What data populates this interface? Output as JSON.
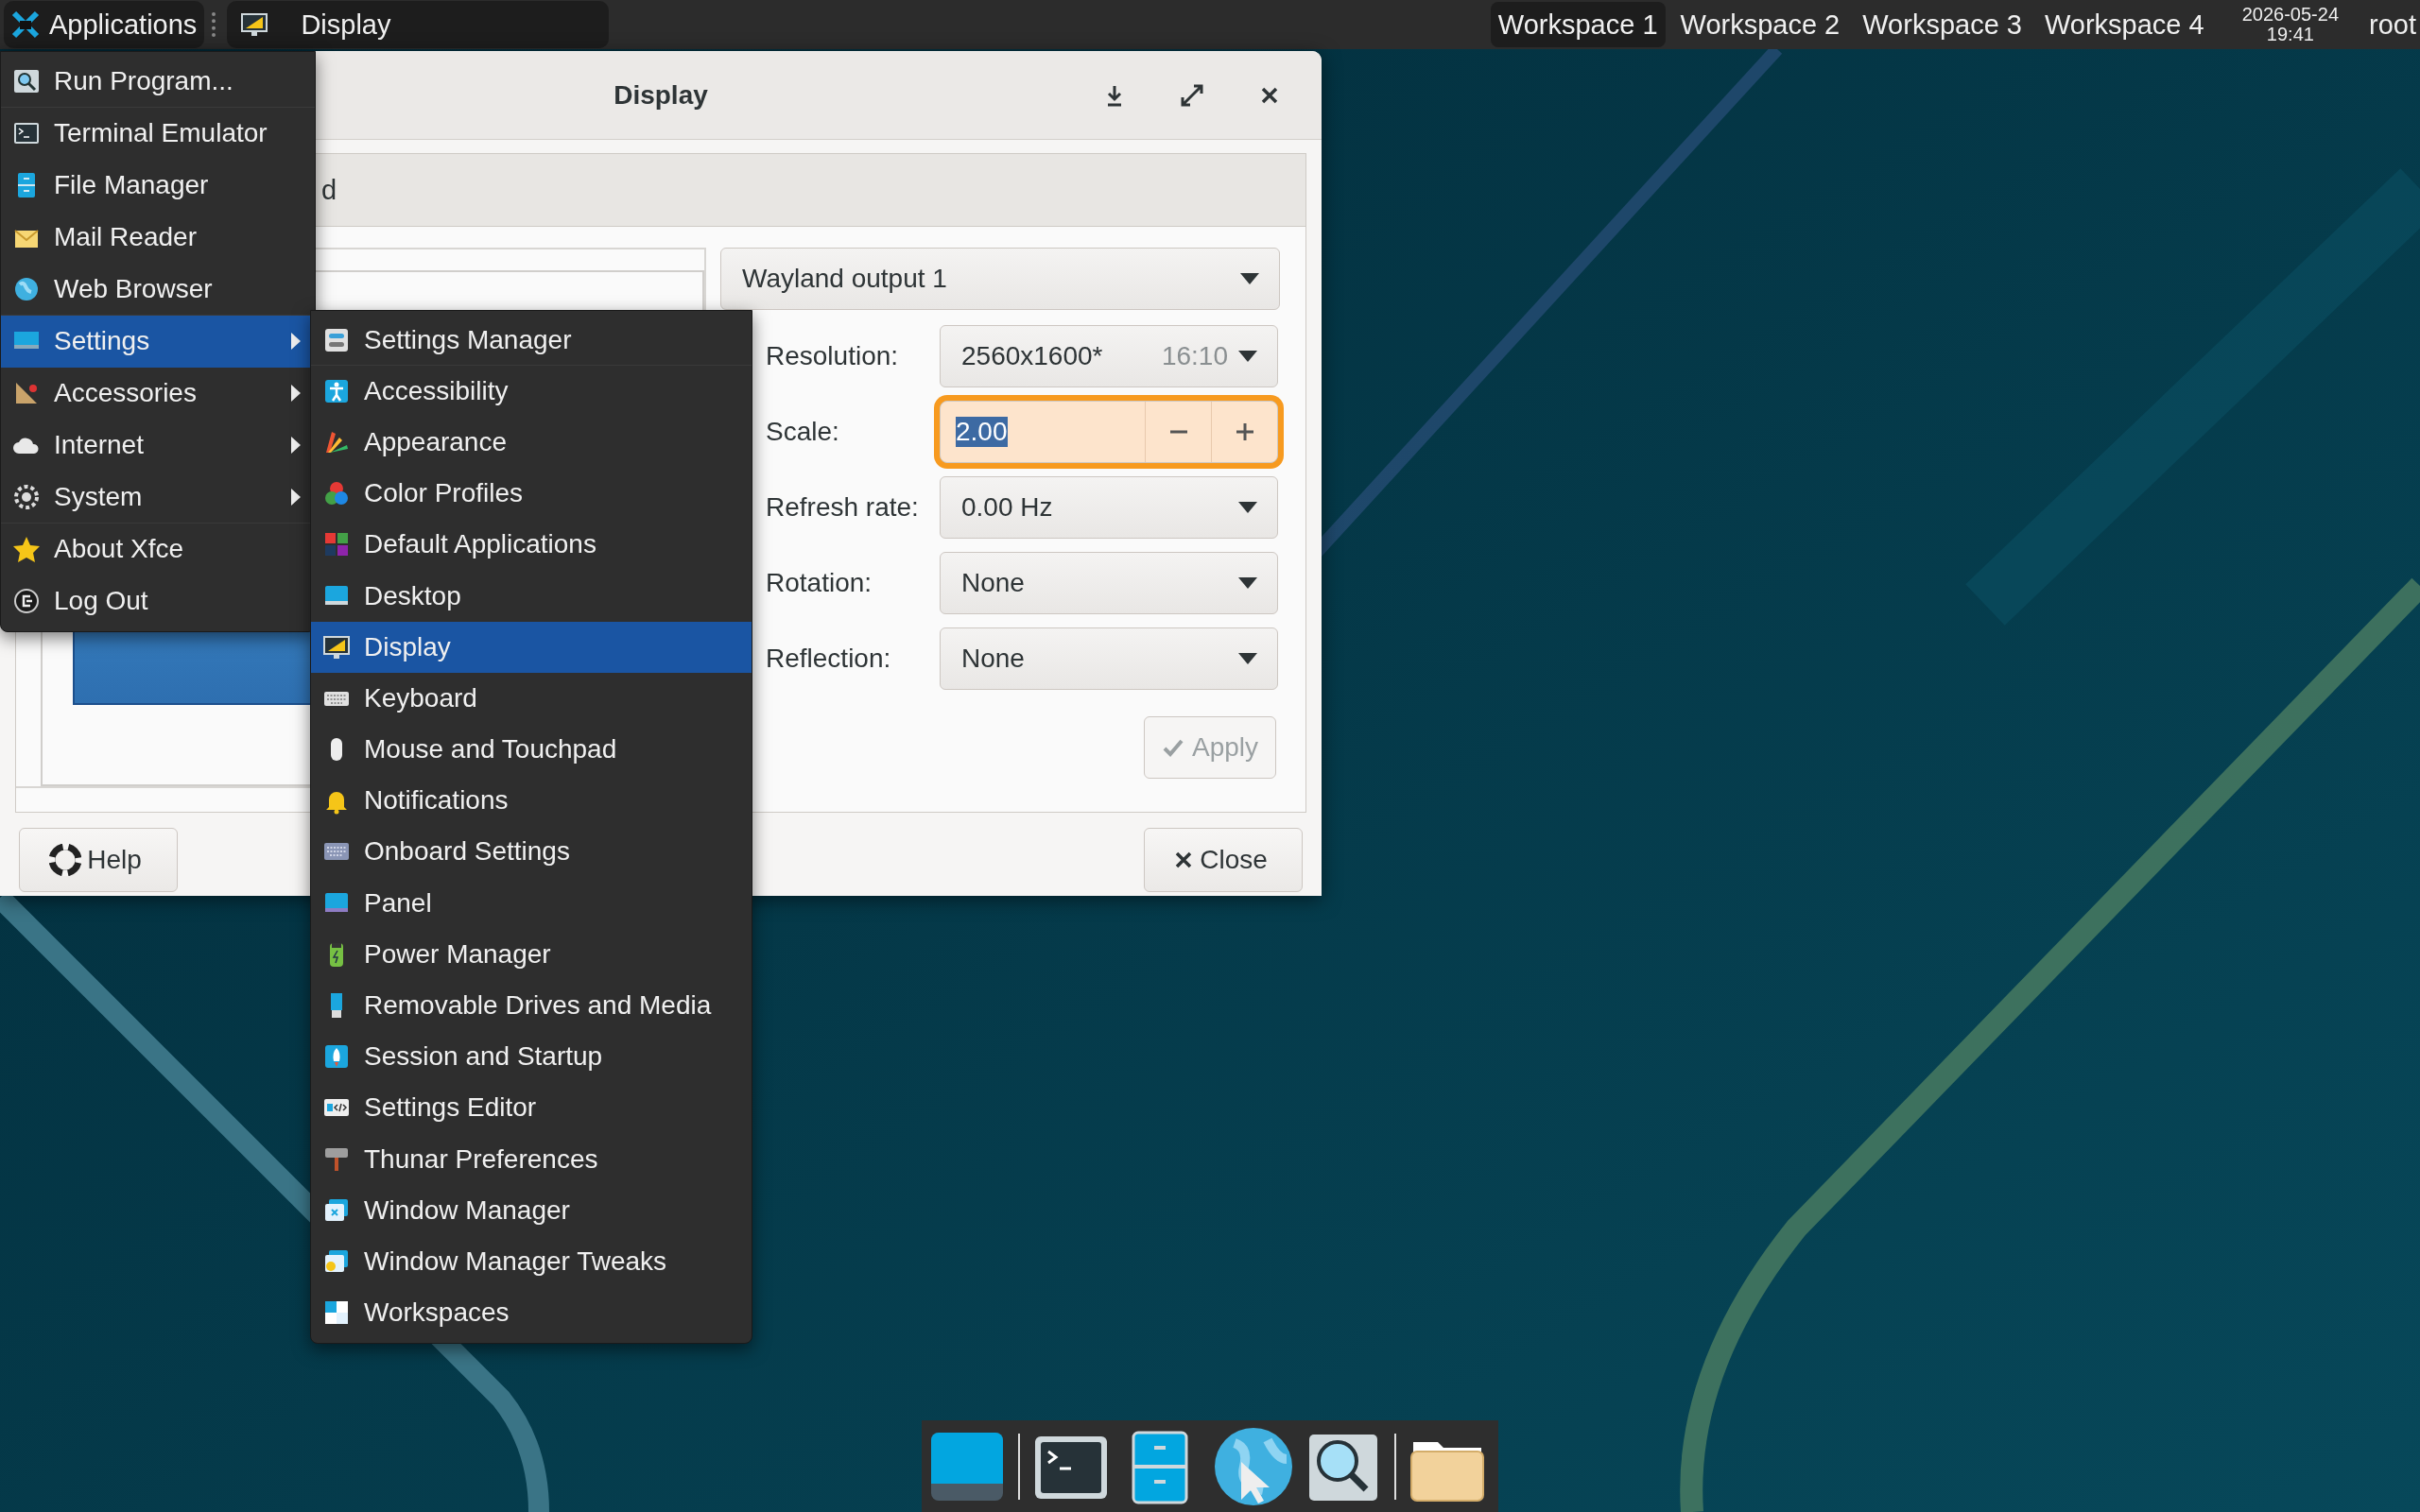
{
  "top_panel": {
    "applications_button": "Applications",
    "tasks": [
      {
        "label": "Display",
        "selected": true
      }
    ],
    "workspaces": [
      {
        "label": "Workspace 1",
        "selected": true
      },
      {
        "label": "Workspace 2",
        "selected": false
      },
      {
        "label": "Workspace 3",
        "selected": false
      },
      {
        "label": "Workspace 4",
        "selected": false
      }
    ],
    "clock": {
      "date": "2026-05-24",
      "time": "19:41"
    },
    "user": "root"
  },
  "dialog": {
    "title": "Display",
    "tab_fragment": "d",
    "output_select": "Wayland output 1",
    "settings": [
      {
        "label": "Resolution:",
        "kind": "select",
        "value": "2560x1600*",
        "hint": "16:10"
      },
      {
        "label": "Scale:",
        "kind": "spin",
        "value": "2.00",
        "focused": true
      },
      {
        "label": "Refresh rate:",
        "kind": "select",
        "value": "0.00 Hz"
      },
      {
        "label": "Rotation:",
        "kind": "select",
        "value": "None"
      },
      {
        "label": "Reflection:",
        "kind": "select",
        "value": "None"
      }
    ],
    "apply_button": {
      "label": "Apply",
      "disabled": true
    },
    "help_button": "Help",
    "close_button": "Close"
  },
  "applications_menu": {
    "items": [
      {
        "label": "Run Program...",
        "submenu": false,
        "selected": false
      },
      {
        "label": "Terminal Emulator",
        "submenu": false,
        "selected": false
      },
      {
        "label": "File Manager",
        "submenu": false,
        "selected": false
      },
      {
        "label": "Mail Reader",
        "submenu": false,
        "selected": false
      },
      {
        "label": "Web Browser",
        "submenu": false,
        "selected": false
      },
      {
        "label": "Settings",
        "submenu": true,
        "selected": true
      },
      {
        "label": "Accessories",
        "submenu": true,
        "selected": false
      },
      {
        "label": "Internet",
        "submenu": true,
        "selected": false
      },
      {
        "label": "System",
        "submenu": true,
        "selected": false
      },
      {
        "label": "About Xfce",
        "submenu": false,
        "selected": false
      },
      {
        "label": "Log Out",
        "submenu": false,
        "selected": false
      }
    ]
  },
  "settings_submenu": {
    "items": [
      {
        "label": "Settings Manager",
        "selected": false
      },
      {
        "label": "Accessibility",
        "selected": false
      },
      {
        "label": "Appearance",
        "selected": false
      },
      {
        "label": "Color Profiles",
        "selected": false
      },
      {
        "label": "Default Applications",
        "selected": false
      },
      {
        "label": "Desktop",
        "selected": false
      },
      {
        "label": "Display",
        "selected": true
      },
      {
        "label": "Keyboard",
        "selected": false
      },
      {
        "label": "Mouse and Touchpad",
        "selected": false
      },
      {
        "label": "Notifications",
        "selected": false
      },
      {
        "label": "Onboard Settings",
        "selected": false
      },
      {
        "label": "Panel",
        "selected": false
      },
      {
        "label": "Power Manager",
        "selected": false
      },
      {
        "label": "Removable Drives and Media",
        "selected": false
      },
      {
        "label": "Session and Startup",
        "selected": false
      },
      {
        "label": "Settings Editor",
        "selected": false
      },
      {
        "label": "Thunar Preferences",
        "selected": false
      },
      {
        "label": "Window Manager",
        "selected": false
      },
      {
        "label": "Window Manager Tweaks",
        "selected": false
      },
      {
        "label": "Workspaces",
        "selected": false
      }
    ]
  }
}
